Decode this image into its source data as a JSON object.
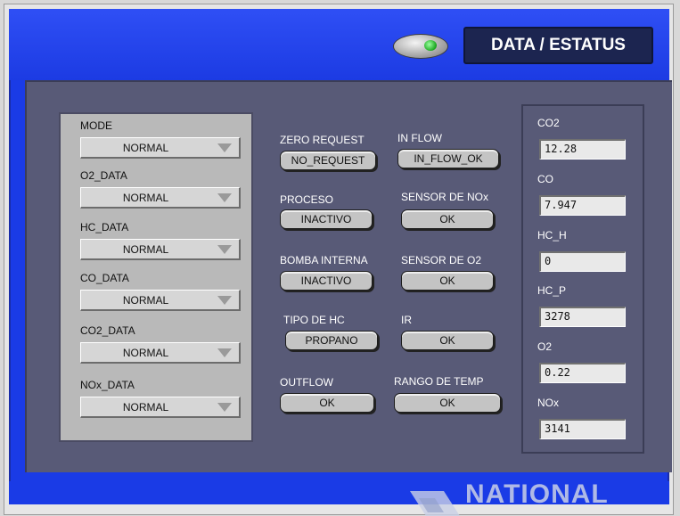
{
  "header": {
    "indicator_icon": "led-indicator-icon",
    "status_button": "DATA / ESTATUS"
  },
  "modes": [
    {
      "label": "MODE",
      "value": "NORMAL"
    },
    {
      "label": "O2_DATA",
      "value": "NORMAL"
    },
    {
      "label": "HC_DATA",
      "value": "NORMAL"
    },
    {
      "label": "CO_DATA",
      "value": "NORMAL"
    },
    {
      "label": "CO2_DATA",
      "value": "NORMAL"
    },
    {
      "label": "NOx_DATA",
      "value": "NORMAL"
    }
  ],
  "status_left": [
    {
      "label": "ZERO REQUEST",
      "value": "NO_REQUEST"
    },
    {
      "label": "PROCESO",
      "value": "INACTIVO"
    },
    {
      "label": "BOMBA INTERNA",
      "value": "INACTIVO"
    },
    {
      "label": "TIPO DE HC",
      "value": "PROPANO"
    },
    {
      "label": "OUTFLOW",
      "value": "OK"
    }
  ],
  "status_right": [
    {
      "label": "IN FLOW",
      "value": "IN_FLOW_OK"
    },
    {
      "label": "SENSOR DE NOx",
      "value": "OK"
    },
    {
      "label": "SENSOR DE O2",
      "value": "OK"
    },
    {
      "label": "IR",
      "value": "OK"
    },
    {
      "label": "RANGO DE TEMP",
      "value": "OK"
    }
  ],
  "readings": [
    {
      "label": "CO2",
      "value": "12.28"
    },
    {
      "label": "CO",
      "value": "7.947"
    },
    {
      "label": "HC_H",
      "value": "0"
    },
    {
      "label": "HC_P",
      "value": "3278"
    },
    {
      "label": "O2",
      "value": "0.22"
    },
    {
      "label": "NOx",
      "value": "3141"
    }
  ],
  "watermark": "NATIONAL",
  "colors": {
    "outer_frame": "#1a3be6",
    "inner_panel": "#585a77",
    "mode_panel": "#b9b9b9",
    "status_button_bg": "#1c2550",
    "led_green": "#19a61e"
  }
}
